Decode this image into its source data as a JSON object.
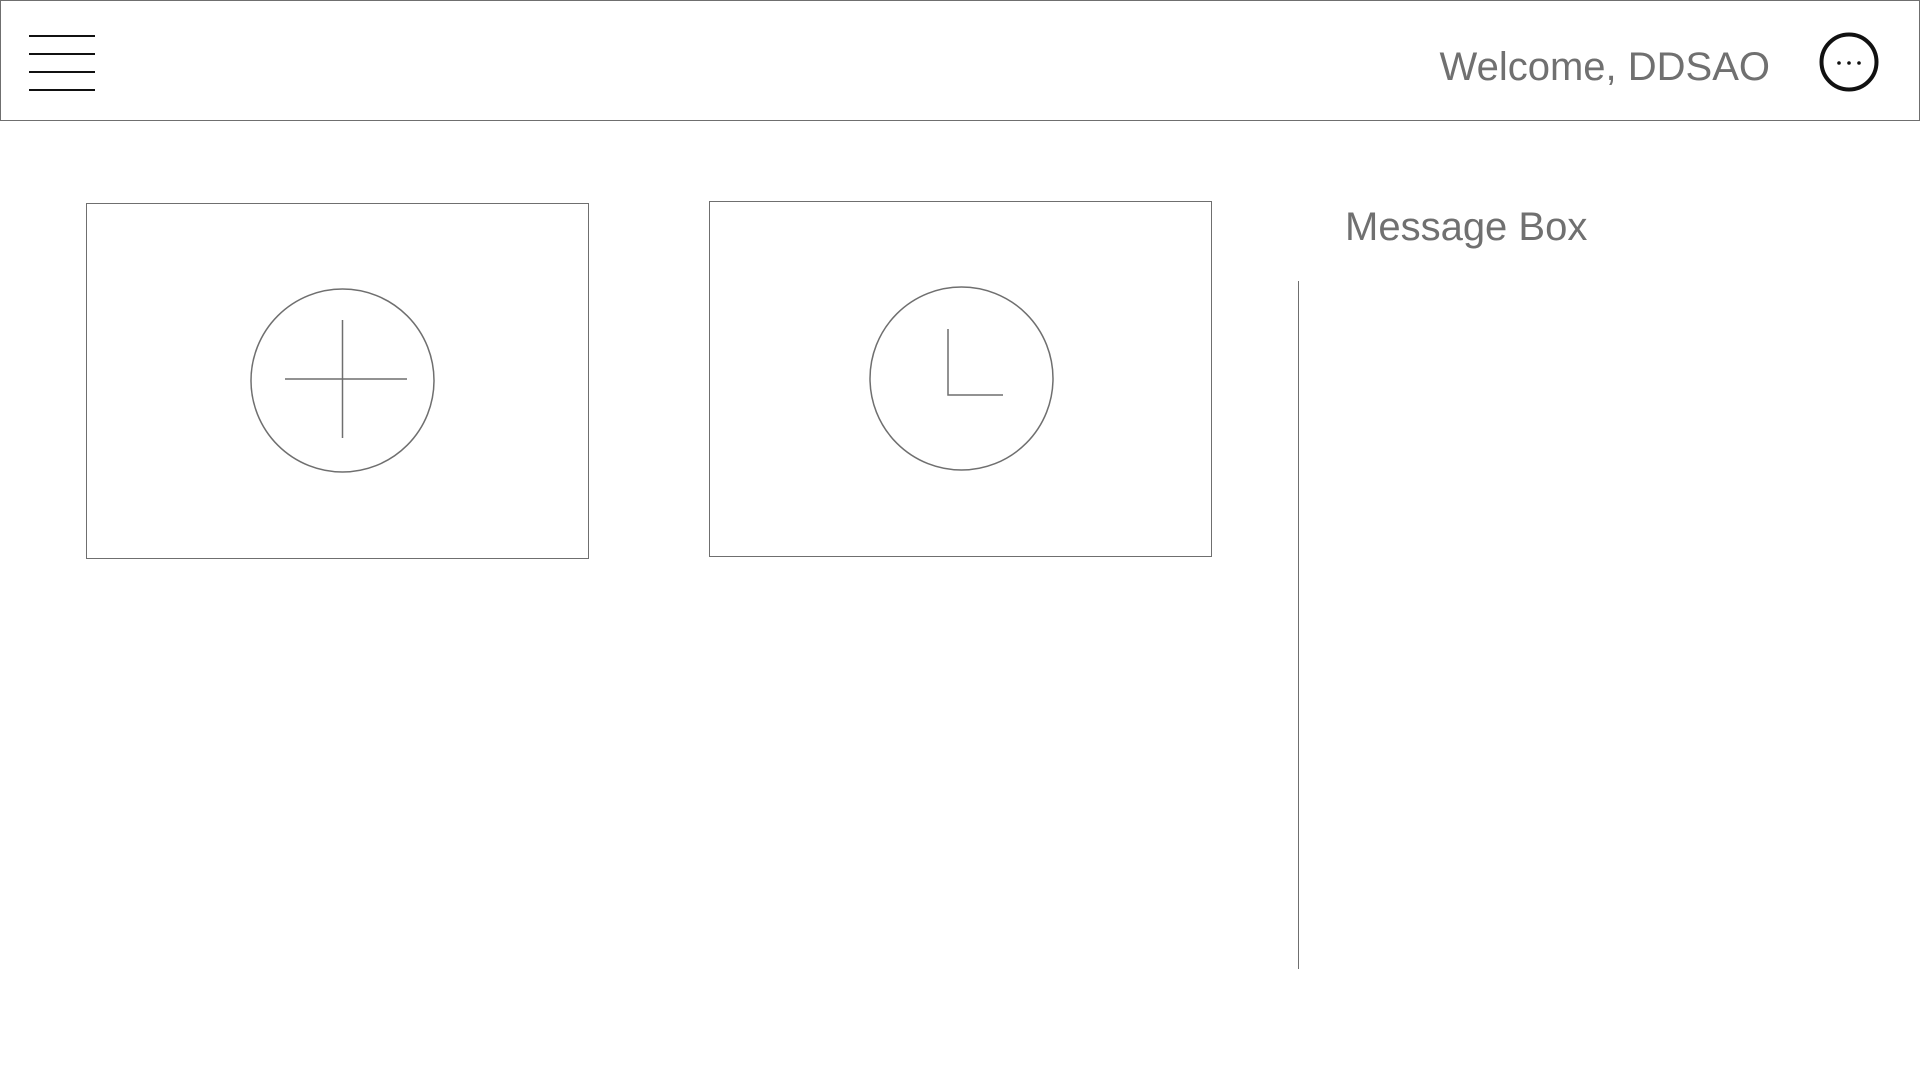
{
  "header": {
    "menu_icon": "hamburger-menu-icon",
    "welcome_text": "Welcome, DDSAO",
    "more_icon": "more-options-icon"
  },
  "cards": [
    {
      "icon": "add-circle-icon"
    },
    {
      "icon": "clock-icon"
    }
  ],
  "message_box": {
    "title": "Message Box",
    "messages": []
  },
  "colors": {
    "border": "#6f6f6f",
    "text": "#707070",
    "icon_dark": "#111111"
  }
}
